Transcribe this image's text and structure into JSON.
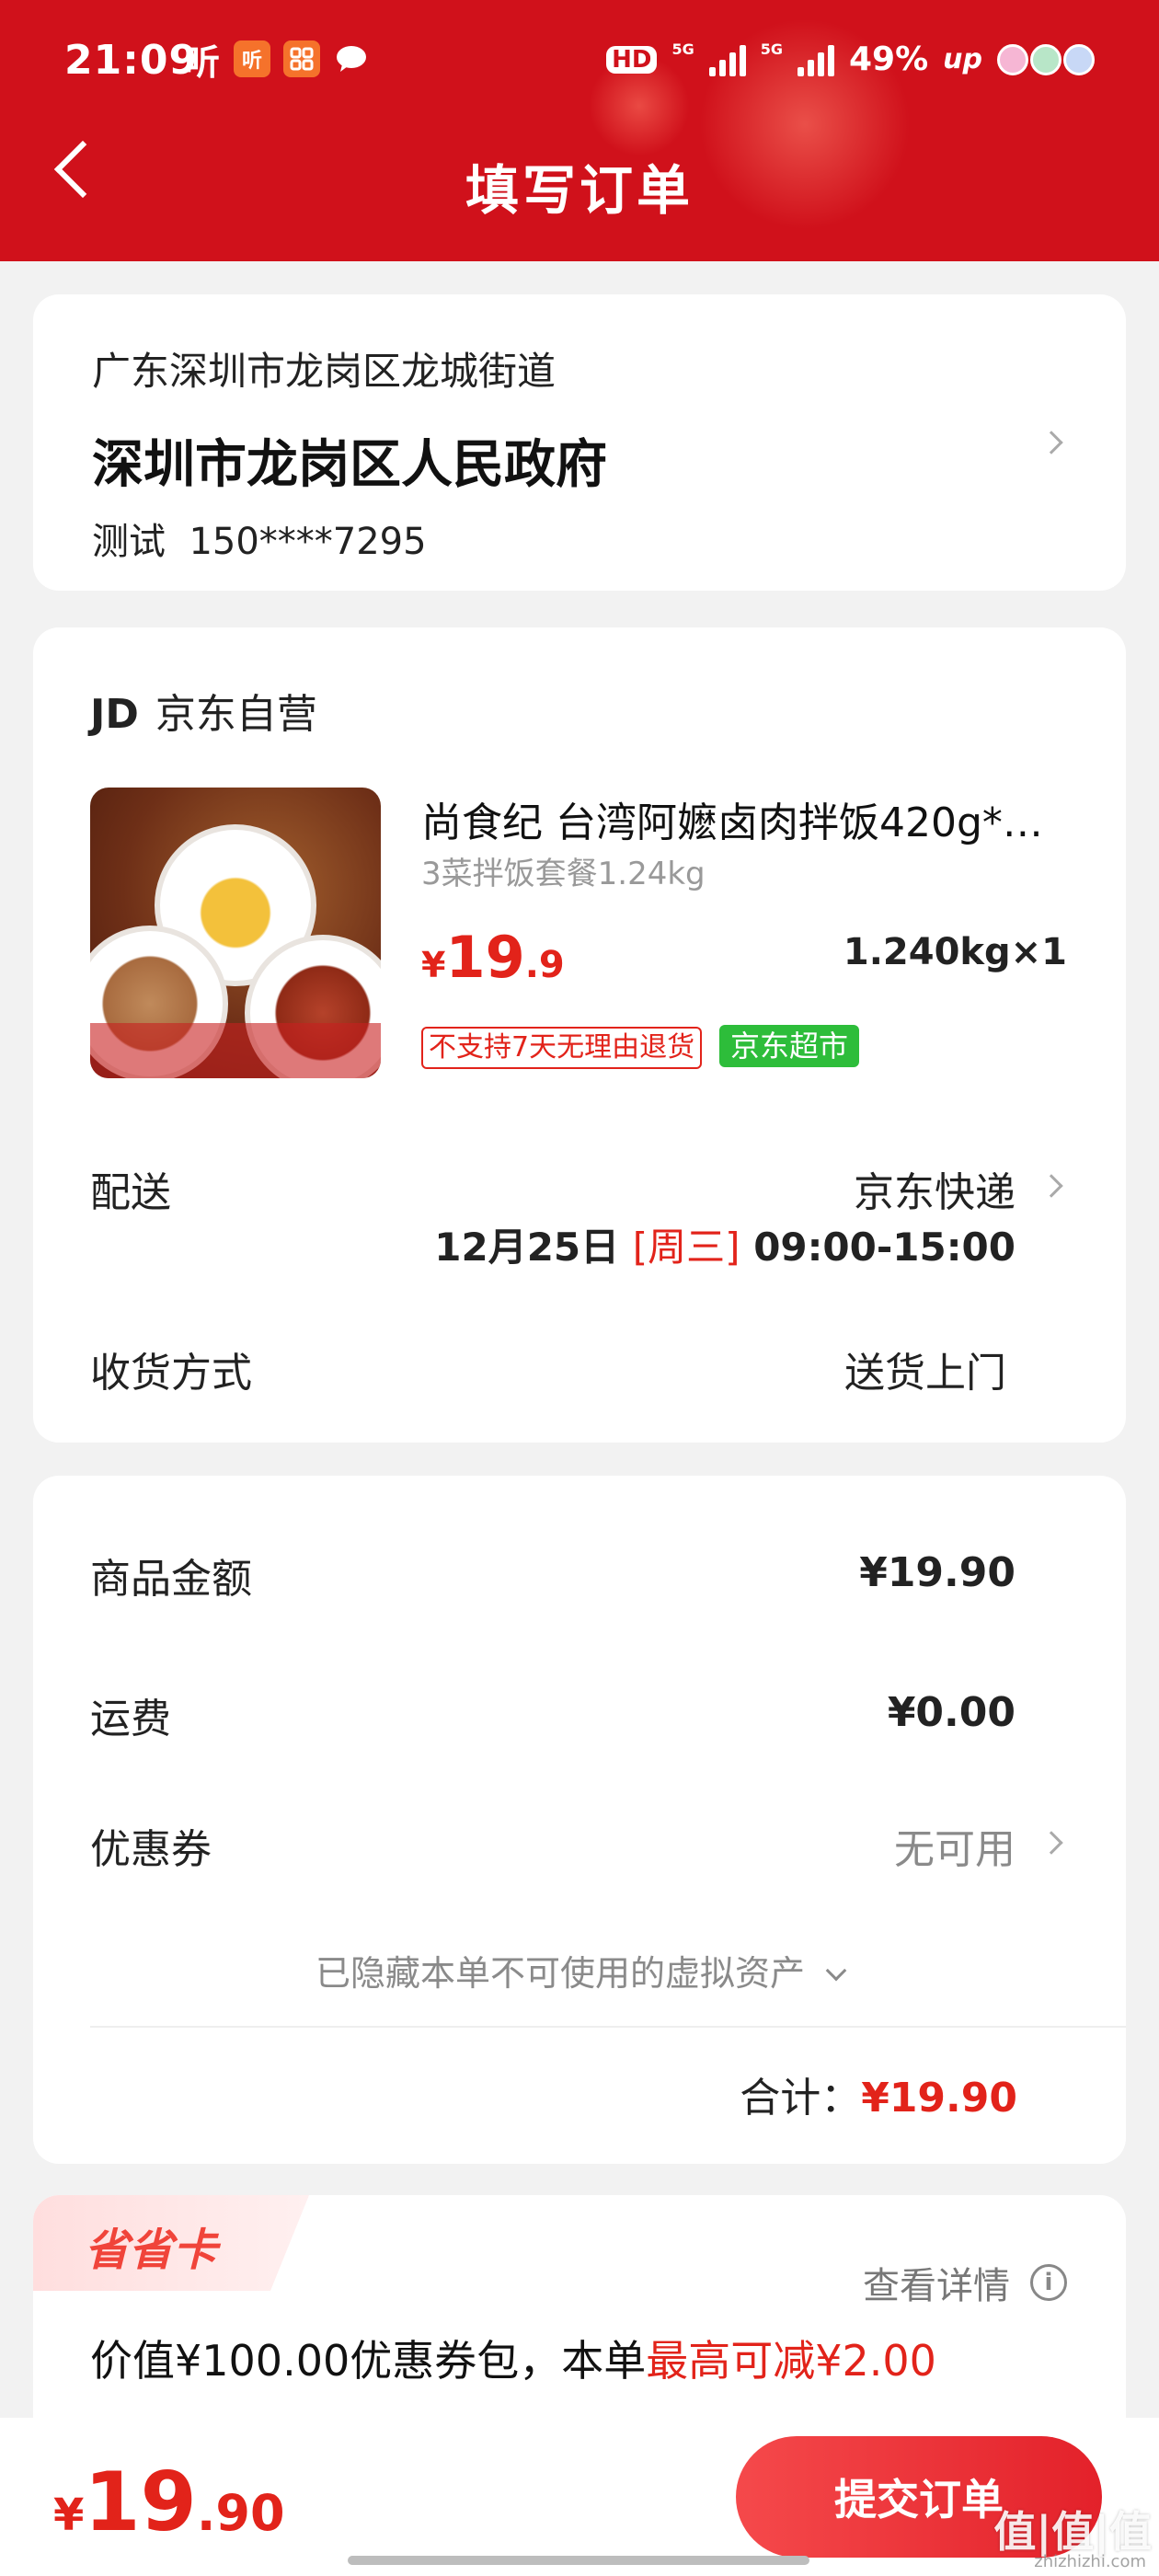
{
  "status_bar": {
    "time": "21:09",
    "app_icon_1": "听",
    "app_icon_2": "听",
    "hd": "HD",
    "net1": "5G",
    "net2": "5G",
    "battery": "49%",
    "up": "up"
  },
  "header": {
    "title": "填写订单"
  },
  "address": {
    "region": "广东深圳市龙岗区龙城街道",
    "detail": "深圳市龙岗区人民政府",
    "contact_name": "测试",
    "phone": "150****7295"
  },
  "shop": {
    "logo": "JD",
    "name": "京东自营",
    "product": {
      "title": "尚食纪 台湾阿嬷卤肉拌饭420g*…",
      "spec": "3菜拌饭套餐1.24kg",
      "price_symbol": "¥",
      "price_int": "19",
      "price_dec": ".9",
      "qty": "1.240kg×1",
      "tag_no_return": "不支持7天无理由退货",
      "tag_market": "京东超市"
    },
    "delivery_label": "配送",
    "delivery_method": "京东快递",
    "delivery_date": "12月25日",
    "delivery_weekday": "[周三]",
    "delivery_time": "09:00-15:00",
    "receive_label": "收货方式",
    "receive_value": "送货上门"
  },
  "summary": {
    "goods_label": "商品金额",
    "goods_value": "¥19.90",
    "shipping_label": "运费",
    "shipping_value": "¥0.00",
    "coupon_label": "优惠券",
    "coupon_value": "无可用",
    "hidden_note": "已隐藏本单不可使用的虚拟资产",
    "total_label": "合计：",
    "total_value": "¥19.90"
  },
  "save_card": {
    "title": "省省卡",
    "detail_link": "查看详情",
    "offer_prefix": "价值¥100.00优惠券包，本单",
    "offer_highlight": "最高可减¥2.00"
  },
  "bottom_bar": {
    "price_symbol": "¥",
    "price_int": "19",
    "price_dec": ".90",
    "submit_label": "提交订单"
  },
  "watermark": {
    "text": "值|值|值",
    "sub": "zhizhizhi.com"
  },
  "colors": {
    "brand_red": "#d0111b",
    "price_red": "#e2231a",
    "tag_green": "#2dbd3a"
  }
}
